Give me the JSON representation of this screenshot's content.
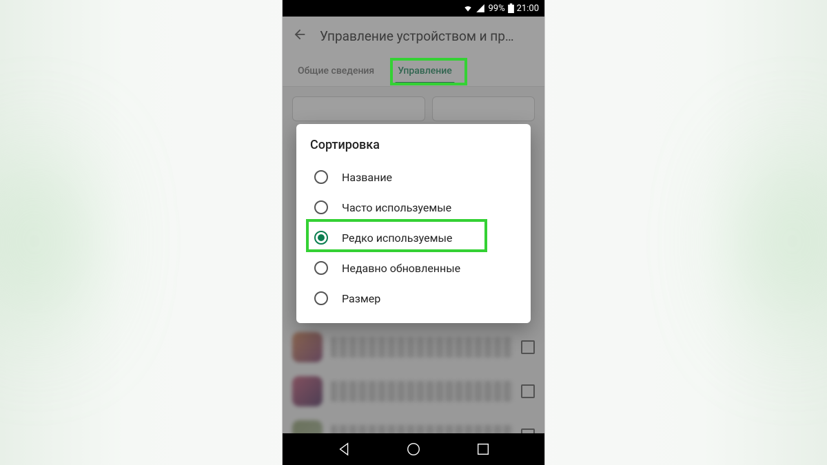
{
  "status": {
    "battery_percent": "99%",
    "time": "21:00"
  },
  "header": {
    "title": "Управление устройством и пр…"
  },
  "tabs": {
    "overview": "Общие сведения",
    "manage": "Управление"
  },
  "dialog": {
    "title": "Сортировка",
    "options": {
      "name": "Название",
      "frequent": "Часто используемые",
      "rare": "Редко используемые",
      "recent": "Недавно обновленные",
      "size": "Размер"
    }
  }
}
